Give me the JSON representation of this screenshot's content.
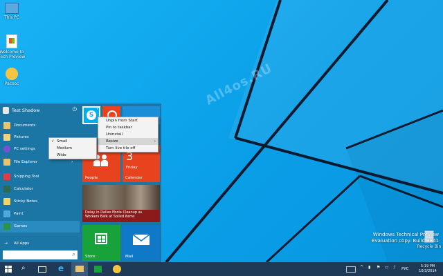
{
  "desktop": {
    "watermark": "All4os.RU",
    "icons": [
      {
        "label": "This PC",
        "icon": "computer-icon"
      },
      {
        "label": "Welcome to Tech Preview",
        "icon": "document-icon"
      },
      {
        "label": "Pacsoc",
        "icon": "game-icon"
      }
    ],
    "recycle_bin_label": "Recycle Bin",
    "build_info": {
      "line1": "Windows Technical Preview",
      "line2": "Evaluation copy. Build 9841"
    }
  },
  "start_menu": {
    "user_name": "Test Shadow",
    "items": [
      {
        "label": "Documents",
        "icon": "folder-icon",
        "color": "#e9c46a"
      },
      {
        "label": "Pictures",
        "icon": "pictures-icon",
        "color": "#f0d27a"
      },
      {
        "label": "PC settings",
        "icon": "gear-icon",
        "color": "#7b4fd1"
      },
      {
        "label": "File Explorer",
        "icon": "folder-icon",
        "color": "#e9c46a"
      },
      {
        "label": "Snipping Tool",
        "icon": "scissors-icon",
        "color": "#e63946"
      },
      {
        "label": "Calculator",
        "icon": "calculator-icon",
        "color": "#2d6a4f"
      },
      {
        "label": "Sticky Notes",
        "icon": "note-icon",
        "color": "#f4d35e"
      },
      {
        "label": "Paint",
        "icon": "paint-icon",
        "color": "#4ea8de"
      },
      {
        "label": "Games",
        "icon": "games-icon",
        "color": "#2b9348"
      }
    ],
    "all_apps_label": "All Apps",
    "tiles": {
      "skype": {
        "label": ""
      },
      "people": {
        "label": "People"
      },
      "calendar": {
        "label": "Calendar",
        "day_number": "3",
        "day_name": "Friday"
      },
      "news": {
        "headline": "Delay in Dallas Ebola Cleanup as Workers Balk at Soiled Items"
      },
      "store": {
        "label": "Store"
      },
      "mail": {
        "label": "Mail"
      }
    }
  },
  "context_menu": {
    "items": [
      "Unpin from Start",
      "Pin to taskbar",
      "Uninstall",
      "Resize",
      "Turn live tile off"
    ]
  },
  "resize_submenu": {
    "items": [
      "Small",
      "Medium",
      "Wide"
    ],
    "checked": "Small"
  },
  "taskbar": {
    "language": "РУС",
    "time": "5:19 PM",
    "date": "10/3/2014"
  }
}
